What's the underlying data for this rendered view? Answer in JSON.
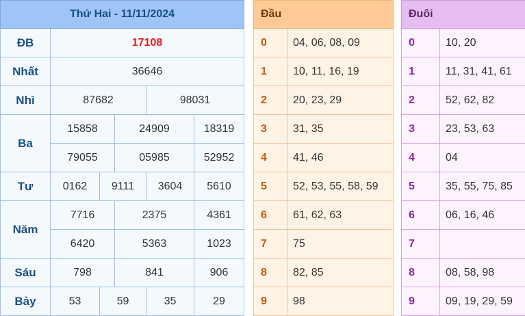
{
  "results": {
    "title": "Thứ Hai - 11/11/2024",
    "rows": {
      "db": {
        "label": "ĐB",
        "values": [
          "17108"
        ]
      },
      "nhat": {
        "label": "Nhất",
        "values": [
          "36646"
        ]
      },
      "nhi": {
        "label": "Nhì",
        "values": [
          "87682",
          "98031"
        ]
      },
      "ba": {
        "label": "Ba",
        "values": [
          "15858",
          "24909",
          "18319",
          "79055",
          "05985",
          "52952"
        ]
      },
      "tu": {
        "label": "Tư",
        "values": [
          "0162",
          "9111",
          "3604",
          "5610"
        ]
      },
      "nam": {
        "label": "Năm",
        "values": [
          "7716",
          "2375",
          "4361",
          "6420",
          "5363",
          "1023"
        ]
      },
      "sau": {
        "label": "Sáu",
        "values": [
          "798",
          "841",
          "906"
        ]
      },
      "bay": {
        "label": "Bảy",
        "values": [
          "53",
          "59",
          "35",
          "29"
        ]
      }
    },
    "colors": {
      "header_bg": "#9ec5f5",
      "label_text": "#1a4f86",
      "special_text": "#e32020"
    }
  },
  "dau": {
    "title": "Đầu",
    "rows": [
      {
        "key": "0",
        "value": "04, 06, 08, 09"
      },
      {
        "key": "1",
        "value": "10, 11, 16, 19"
      },
      {
        "key": "2",
        "value": "20, 23, 29"
      },
      {
        "key": "3",
        "value": "31, 35"
      },
      {
        "key": "4",
        "value": "41, 46"
      },
      {
        "key": "5",
        "value": "52, 53, 55, 58, 59"
      },
      {
        "key": "6",
        "value": "61, 62, 63"
      },
      {
        "key": "7",
        "value": "75"
      },
      {
        "key": "8",
        "value": "82, 85"
      },
      {
        "key": "9",
        "value": "98"
      }
    ],
    "colors": {
      "header_bg": "#ffc996",
      "key_text": "#c25a10"
    }
  },
  "duoi": {
    "title": "Đuôi",
    "rows": [
      {
        "key": "0",
        "value": "10, 20"
      },
      {
        "key": "1",
        "value": "11, 31, 41, 61"
      },
      {
        "key": "2",
        "value": "52, 62, 82"
      },
      {
        "key": "3",
        "value": "23, 53, 63"
      },
      {
        "key": "4",
        "value": "04"
      },
      {
        "key": "5",
        "value": "35, 55, 75, 85"
      },
      {
        "key": "6",
        "value": "06, 16, 46"
      },
      {
        "key": "7",
        "value": ""
      },
      {
        "key": "8",
        "value": "08, 58, 98"
      },
      {
        "key": "9",
        "value": "09, 19, 29, 59"
      }
    ],
    "colors": {
      "header_bg": "#e6bdf0",
      "key_text": "#8a2aa0"
    }
  }
}
